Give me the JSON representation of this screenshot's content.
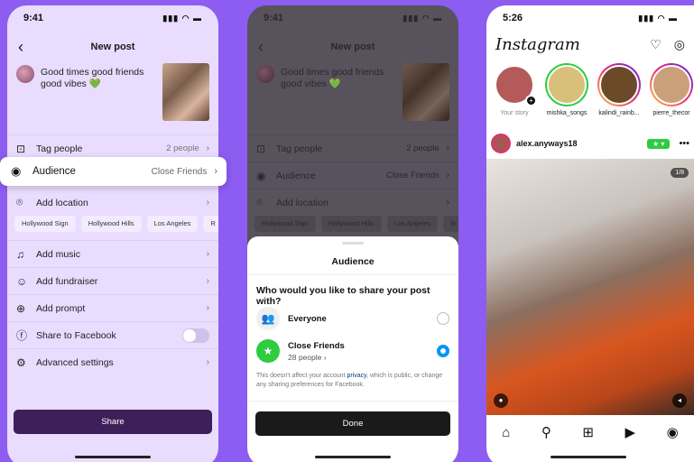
{
  "phone1": {
    "time": "9:41",
    "title": "New post",
    "caption": "Good times good friends good vibes 💚",
    "rows": [
      {
        "icon": "⊡",
        "label": "Tag people",
        "value": "2 people"
      },
      {
        "icon": "◉",
        "label": "Audience",
        "value": "Close Friends"
      },
      {
        "icon": "⌾",
        "label": "Add location",
        "value": ""
      },
      {
        "icon": "♫",
        "label": "Add music",
        "value": ""
      },
      {
        "icon": "☺",
        "label": "Add fundraiser",
        "value": ""
      },
      {
        "icon": "⊕",
        "label": "Add prompt",
        "value": ""
      },
      {
        "icon": "ⓕ",
        "label": "Share to Facebook",
        "value": ""
      },
      {
        "icon": "⚙",
        "label": "Advanced settings",
        "value": ""
      }
    ],
    "locations": [
      "Hollywood Sign",
      "Hollywood Hills",
      "Los Angeles",
      "R"
    ],
    "share_label": "Share"
  },
  "phone2": {
    "time": "9:41",
    "title": "New post",
    "caption": "Good times good friends good vibes 💚",
    "rows": [
      {
        "icon": "⊡",
        "label": "Tag people",
        "value": "2 people"
      },
      {
        "icon": "◉",
        "label": "Audience",
        "value": "Close Friends"
      },
      {
        "icon": "⌾",
        "label": "Add location",
        "value": ""
      }
    ],
    "locations": [
      "Hollywood Sign",
      "Hollywood Hills",
      "Los Angeles",
      "R"
    ],
    "sheet": {
      "title": "Audience",
      "question": "Who would you like to share your post with?",
      "options": [
        {
          "label": "Everyone",
          "sub": "",
          "selected": false
        },
        {
          "label": "Close Friends",
          "sub": "28 people ›",
          "selected": true
        }
      ],
      "note_before": "This doesn't affect your account ",
      "note_link": "privacy",
      "note_after": ", which is public, or change any sharing preferences for Facebook.",
      "done_label": "Done"
    }
  },
  "phone3": {
    "time": "5:26",
    "logo": "Instagram",
    "stories": [
      {
        "name": "Your story",
        "ring": "none",
        "color": "#b45a5a"
      },
      {
        "name": "mishka_songs",
        "ring": "green",
        "color": "#d8c07a"
      },
      {
        "name": "kalindi_rainb...",
        "ring": "gradient",
        "color": "#6b4a2a"
      },
      {
        "name": "pierre_thecor",
        "ring": "gradient",
        "color": "#c9a07a"
      }
    ],
    "post_user": "alex.anyways18",
    "close_friends_badge": "★ ▾",
    "counter": "1/8"
  },
  "colors": {
    "background": "#8d5cf0",
    "accent": "#0095f6",
    "close_friends": "#2ecc40"
  }
}
